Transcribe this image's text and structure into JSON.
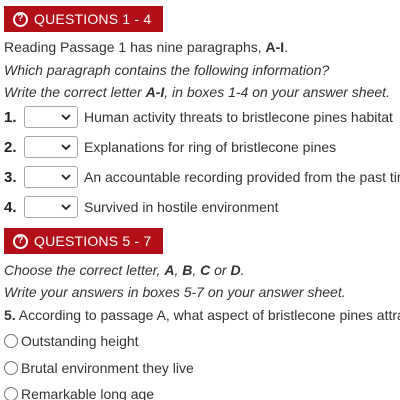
{
  "section1": {
    "header": "QUESTIONS 1 - 4",
    "instr1_pre": "Reading Passage 1 has nine paragraphs, ",
    "instr1_bold": "A-I",
    "instr1_post": ".",
    "instr2": "Which paragraph contains the following information?",
    "instr3_pre": "Write the correct letter ",
    "instr3_bold": "A-I",
    "instr3_post": ", in boxes 1-4 on your answer sheet.",
    "questions": [
      {
        "num": "1.",
        "text": "Human activity threats to bristlecone pines habitat",
        "selected": ""
      },
      {
        "num": "2.",
        "text": "Explanations for ring of bristlecone pines",
        "selected": ""
      },
      {
        "num": "3.",
        "text": "An accountable recording provided from the past tim",
        "selected": ""
      },
      {
        "num": "4.",
        "text": "Survived in hostile environment",
        "selected": ""
      }
    ]
  },
  "section2": {
    "header": "QUESTIONS 5 - 7",
    "instr1_pre": "Choose the correct letter, ",
    "instr1_a": "A",
    "instr1_sep1": ", ",
    "instr1_b": "B",
    "instr1_sep2": ", ",
    "instr1_c": "C",
    "instr1_or": " or ",
    "instr1_d": "D",
    "instr1_post": ".",
    "instr2": "Write your answers in boxes 5-7 on your answer sheet.",
    "q5_num": "5.",
    "q5_text": " According to passage A, what aspect of bristlecone pines attra",
    "options": [
      "Outstanding height",
      "Brutal environment they live",
      "Remarkable long age"
    ]
  },
  "colors": {
    "header_bg": "#b30f19",
    "text": "#333333"
  },
  "icons": {
    "header_icon": "question-circle-icon",
    "select_icon": "chevron-down-icon"
  }
}
